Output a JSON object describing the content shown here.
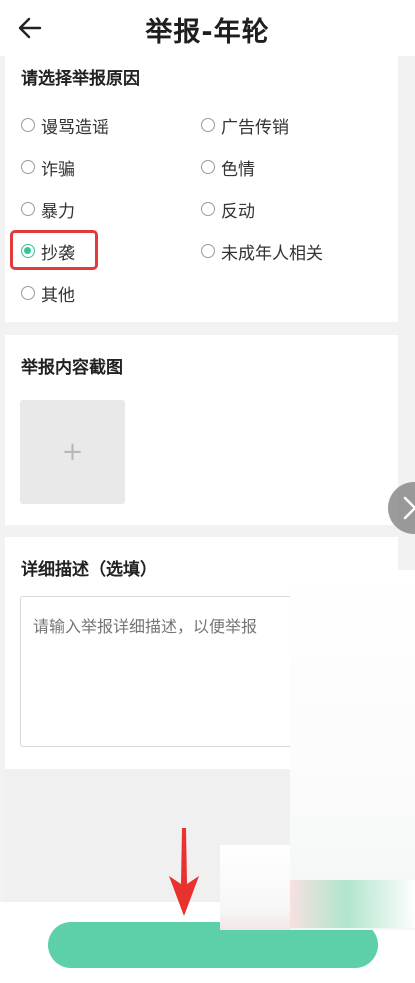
{
  "header": {
    "title": "举报-年轮",
    "back_icon": "arrow-left-icon"
  },
  "reasons": {
    "title": "请选择举报原因",
    "selected": "抄袭",
    "accent_color": "#35c596",
    "highlight_color": "#e23b3b",
    "options": [
      {
        "label": "谩骂造谣",
        "checked": false
      },
      {
        "label": "广告传销",
        "checked": false
      },
      {
        "label": "诈骗",
        "checked": false
      },
      {
        "label": "色情",
        "checked": false
      },
      {
        "label": "暴力",
        "checked": false
      },
      {
        "label": "反动",
        "checked": false
      },
      {
        "label": "抄袭",
        "checked": true
      },
      {
        "label": "未成年人相关",
        "checked": false
      },
      {
        "label": "其他",
        "checked": false
      }
    ]
  },
  "screenshot": {
    "title": "举报内容截图",
    "add_label": "+",
    "add_icon": "plus-icon"
  },
  "description": {
    "title": "详细描述（选填）",
    "placeholder": "请输入举报详细描述，以便举报"
  },
  "submit": {
    "label": "",
    "color": "#41c79a"
  },
  "side_tab": {
    "icon": "chevron-right-icon"
  }
}
